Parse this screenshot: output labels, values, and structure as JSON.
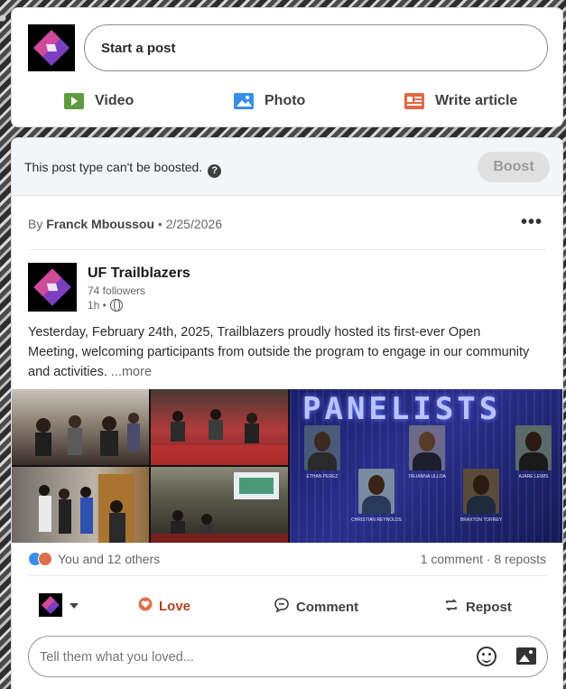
{
  "compose": {
    "placeholder": "Start a post",
    "actions": [
      {
        "label": "Video",
        "icon": "video-icon",
        "color": "#5f9b41"
      },
      {
        "label": "Photo",
        "icon": "photo-icon",
        "color": "#378fe9"
      },
      {
        "label": "Write article",
        "icon": "article-icon",
        "color": "#e06847"
      }
    ]
  },
  "post": {
    "boost_notice": "This post type can't be boosted.",
    "boost_label": "Boost",
    "byline_prefix": "By",
    "byline_author": "Franck Mboussou",
    "byline_date": "2/25/2026",
    "more_label": "•••",
    "org": {
      "name": "UF Trailblazers",
      "followers": "74 followers",
      "time": "1h •"
    },
    "text": "Yesterday, February 24th, 2025, Trailblazers proudly hosted its first-ever Open Meeting, welcoming participants from outside the program to engage in our community and activities.",
    "see_more": "...more",
    "panel_title": "PANELISTS",
    "panelists": [
      "ETHAN PEREZ",
      "TALIANNA ULLOA",
      "AJARE LEWIS",
      "CHRISTIAN REYNOLDS",
      "BRAXTON TORREY"
    ],
    "reactions_text": "You and 12 others",
    "stats": "1 comment · 8 reposts",
    "actions": {
      "love": "Love",
      "comment": "Comment",
      "repost": "Repost"
    },
    "comment_placeholder": "Tell them what you loved..."
  },
  "colors": {
    "love": "#b24020",
    "boost_disabled": "#e0e0e0",
    "panel_bg": "#1a1f6b"
  }
}
